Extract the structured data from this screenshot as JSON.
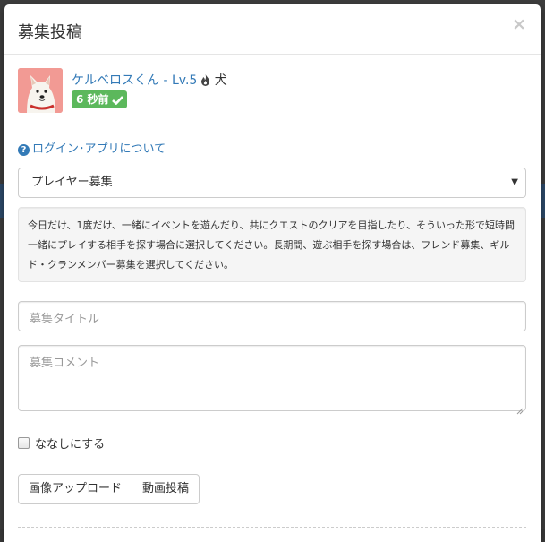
{
  "modal": {
    "title": "募集投稿",
    "close_label": "×"
  },
  "user": {
    "name": "ケルベロスくん - Lv.5",
    "species": "犬",
    "time_ago": "6 秒前",
    "avatar_icon": "shiba-dog-avatar",
    "flame_icon": "flame-icon",
    "verified_icon": "check-icon"
  },
  "help": {
    "label": "ログイン･アプリについて",
    "icon": "question-circle-icon"
  },
  "post_type": {
    "selected": "プレイヤー募集"
  },
  "description": "今日だけ、1度だけ、一緒にイベントを遊んだり、共にクエストのクリアを目指したり、そういった形で短時間一緒にプレイする相手を探す場合に選択してください。長期間、遊ぶ相手を探す場合は、フレンド募集、ギルド・クランメンバー募集を選択してください。",
  "title_input": {
    "placeholder": "募集タイトル",
    "value": ""
  },
  "comment_input": {
    "placeholder": "募集コメント",
    "value": ""
  },
  "anonymous_checkbox": {
    "label": "ななしにする",
    "checked": false
  },
  "buttons": {
    "image_upload": "画像アップロード",
    "video_post": "動画投稿"
  },
  "colors": {
    "link": "#337ab7",
    "badge": "#5cb85c",
    "avatar_bg": "#f29a94"
  }
}
